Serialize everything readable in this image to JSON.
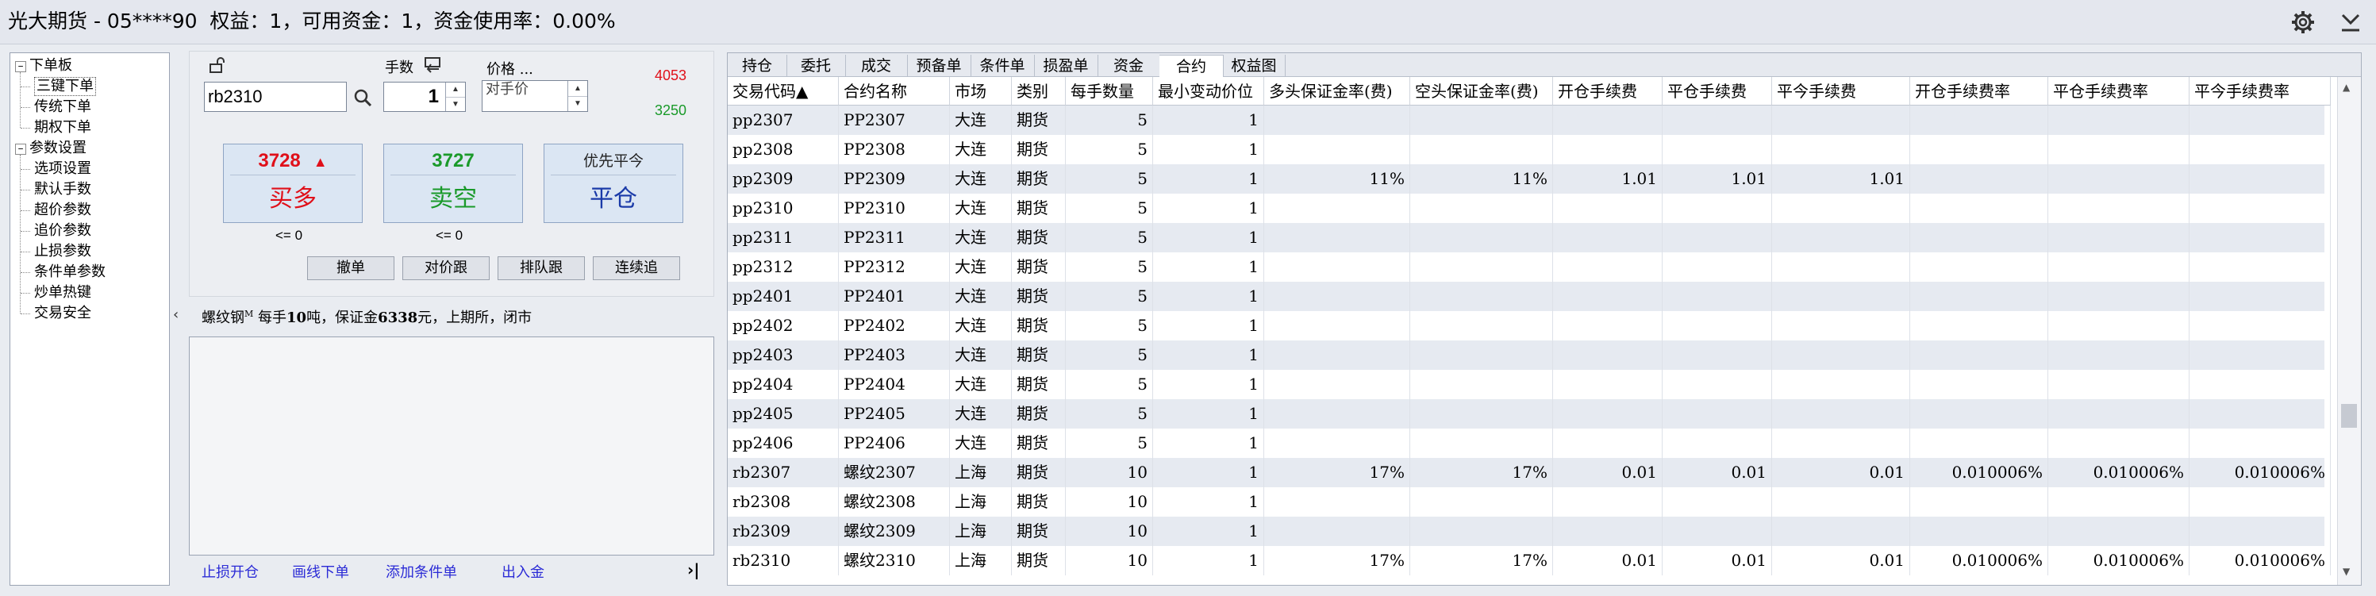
{
  "title": {
    "text": "光大期货 - 05****90  权益：1，可用资金：1，资金使用率：0.00%"
  },
  "tree": {
    "groups": [
      {
        "label": "下单板",
        "children": [
          "三键下单",
          "传统下单",
          "期权下单"
        ]
      },
      {
        "label": "参数设置",
        "children": [
          "选项设置",
          "默认手数",
          "超价参数",
          "追价参数",
          "止损参数",
          "条件单参数",
          "炒单热键",
          "交易安全"
        ]
      }
    ]
  },
  "order": {
    "symbol_value": "rb2310",
    "qty_label": "手数",
    "qty_value": "1",
    "price_label": "价格 ...",
    "price_value": "对手价",
    "upper_limit": "4053",
    "lower_limit": "3250",
    "buy": {
      "price": "3728",
      "label": "买多",
      "sub": "<= 0"
    },
    "sell": {
      "price": "3727",
      "label": "卖空",
      "sub": "<= 0"
    },
    "close": {
      "top": "优先平今",
      "label": "平仓"
    },
    "small_buttons": [
      "撤单",
      "对价跟",
      "排队跟",
      "连续追"
    ]
  },
  "info": {
    "name": "螺纹钢",
    "sup": "M",
    "desc": " 每手",
    "lot": "10",
    "unit": "吨，保证金",
    "margin": "6338",
    "tail": "元，上期所，闭市"
  },
  "footer_links": [
    "止损开仓",
    "画线下单",
    "添加条件单",
    "出入金"
  ],
  "footer_end": "›|",
  "collapse_arrow": "‹",
  "tabs": [
    "持仓",
    "委托",
    "成交",
    "预备单",
    "条件单",
    "损盈单",
    "资金",
    "合约",
    "权益图"
  ],
  "active_tab": 7,
  "columns": [
    "交易代码▲",
    "合约名称",
    "市场",
    "类别",
    "每手数量",
    "最小变动价位",
    "多头保证金率(费)",
    "空头保证金率(费)",
    "开仓手续费",
    "平仓手续费",
    "平今手续费",
    "开仓手续费率",
    "平仓手续费率",
    "平今手续费率"
  ],
  "rows": [
    [
      "pp2307",
      "PP2307",
      "大连",
      "期货",
      "5",
      "1",
      "",
      "",
      "",
      "",
      "",
      "",
      "",
      ""
    ],
    [
      "pp2308",
      "PP2308",
      "大连",
      "期货",
      "5",
      "1",
      "",
      "",
      "",
      "",
      "",
      "",
      "",
      ""
    ],
    [
      "pp2309",
      "PP2309",
      "大连",
      "期货",
      "5",
      "1",
      "11%",
      "11%",
      "1.01",
      "1.01",
      "1.01",
      "",
      "",
      ""
    ],
    [
      "pp2310",
      "PP2310",
      "大连",
      "期货",
      "5",
      "1",
      "",
      "",
      "",
      "",
      "",
      "",
      "",
      ""
    ],
    [
      "pp2311",
      "PP2311",
      "大连",
      "期货",
      "5",
      "1",
      "",
      "",
      "",
      "",
      "",
      "",
      "",
      ""
    ],
    [
      "pp2312",
      "PP2312",
      "大连",
      "期货",
      "5",
      "1",
      "",
      "",
      "",
      "",
      "",
      "",
      "",
      ""
    ],
    [
      "pp2401",
      "PP2401",
      "大连",
      "期货",
      "5",
      "1",
      "",
      "",
      "",
      "",
      "",
      "",
      "",
      ""
    ],
    [
      "pp2402",
      "PP2402",
      "大连",
      "期货",
      "5",
      "1",
      "",
      "",
      "",
      "",
      "",
      "",
      "",
      ""
    ],
    [
      "pp2403",
      "PP2403",
      "大连",
      "期货",
      "5",
      "1",
      "",
      "",
      "",
      "",
      "",
      "",
      "",
      ""
    ],
    [
      "pp2404",
      "PP2404",
      "大连",
      "期货",
      "5",
      "1",
      "",
      "",
      "",
      "",
      "",
      "",
      "",
      ""
    ],
    [
      "pp2405",
      "PP2405",
      "大连",
      "期货",
      "5",
      "1",
      "",
      "",
      "",
      "",
      "",
      "",
      "",
      ""
    ],
    [
      "pp2406",
      "PP2406",
      "大连",
      "期货",
      "5",
      "1",
      "",
      "",
      "",
      "",
      "",
      "",
      "",
      ""
    ],
    [
      "rb2307",
      "螺纹2307",
      "上海",
      "期货",
      "10",
      "1",
      "17%",
      "17%",
      "0.01",
      "0.01",
      "0.01",
      "0.010006%",
      "0.010006%",
      "0.010006%"
    ],
    [
      "rb2308",
      "螺纹2308",
      "上海",
      "期货",
      "10",
      "1",
      "",
      "",
      "",
      "",
      "",
      "",
      "",
      ""
    ],
    [
      "rb2309",
      "螺纹2309",
      "上海",
      "期货",
      "10",
      "1",
      "",
      "",
      "",
      "",
      "",
      "",
      "",
      ""
    ],
    [
      "rb2310",
      "螺纹2310",
      "上海",
      "期货",
      "10",
      "1",
      "17%",
      "17%",
      "0.01",
      "0.01",
      "0.01",
      "0.010006%",
      "0.010006%",
      "0.010006%"
    ]
  ],
  "colors": {
    "buy": "#e0101a",
    "sell": "#1a9a2a",
    "close": "#1a3aa8",
    "link": "#2b2bd6",
    "row_alt": "#e6eaf1"
  }
}
